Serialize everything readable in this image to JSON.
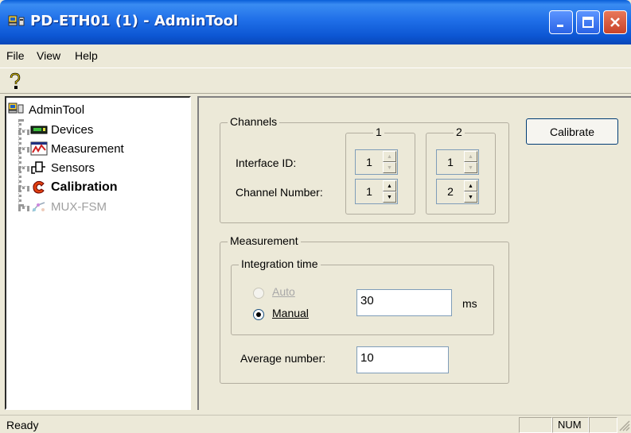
{
  "window": {
    "title": "PD-ETH01 (1) - AdminTool"
  },
  "menu": [
    "File",
    "View",
    "Help"
  ],
  "toolbar": {
    "help_icon": "help-icon"
  },
  "tree": {
    "root": "AdminTool",
    "items": [
      {
        "label": "Devices",
        "icon": "devices-icon"
      },
      {
        "label": "Measurement",
        "icon": "measurement-icon"
      },
      {
        "label": "Sensors",
        "icon": "sensors-icon"
      },
      {
        "label": "Calibration",
        "icon": "calibration-icon",
        "selected": true
      },
      {
        "label": "MUX-FSM",
        "icon": "mux-fsm-icon",
        "disabled": true
      }
    ]
  },
  "channels": {
    "title": "Channels",
    "col1": "1",
    "col2": "2",
    "interface_id_label": "Interface ID:",
    "channel_number_label": "Channel Number:",
    "interface_id_1": "1",
    "interface_id_2": "1",
    "channel_number_1": "1",
    "channel_number_2": "2"
  },
  "measurement": {
    "title": "Measurement",
    "integration_time_title": "Integration time",
    "auto_label": "Auto",
    "manual_label": "Manual",
    "selected_mode": "Manual",
    "time_value": "30",
    "time_unit": "ms",
    "average_label": "Average number:",
    "average_value": "10"
  },
  "calibrate_button": "Calibrate",
  "status": {
    "text": "Ready",
    "num": "NUM"
  }
}
